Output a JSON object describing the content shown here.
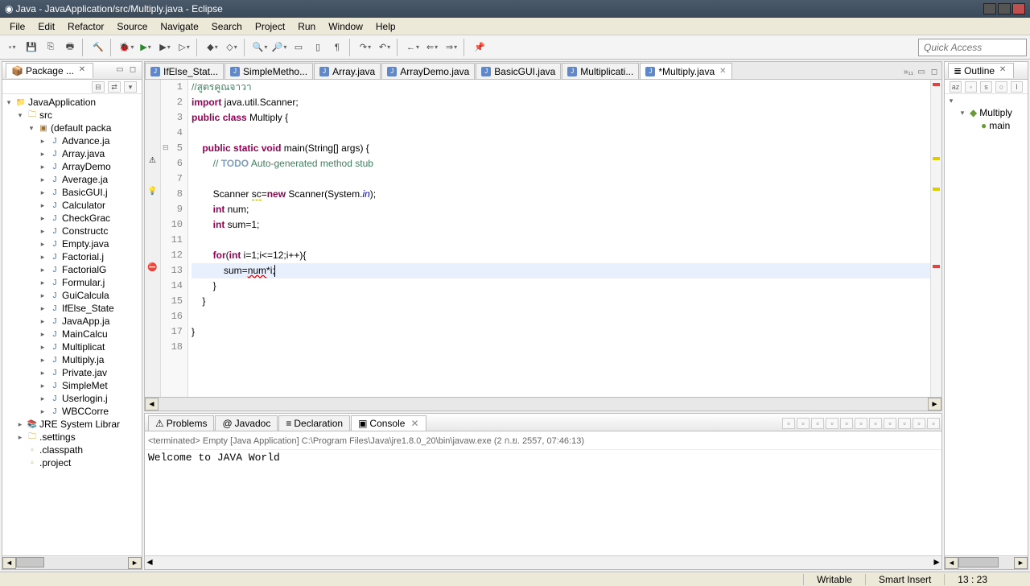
{
  "title": "Java - JavaApplication/src/Multiply.java - Eclipse",
  "menu": [
    "File",
    "Edit",
    "Refactor",
    "Source",
    "Navigate",
    "Search",
    "Project",
    "Run",
    "Window",
    "Help"
  ],
  "quick_access_placeholder": "Quick Access",
  "package_explorer": {
    "title": "Package ...",
    "project": "JavaApplication",
    "src": "src",
    "pkg": "(default packa",
    "files": [
      "Advance.ja",
      "Array.java",
      "ArrayDemo",
      "Average.ja",
      "BasicGUI.j",
      "Calculator",
      "CheckGrac",
      "Constructc",
      "Empty.java",
      "Factorial.j",
      "FactorialG",
      "Formular.j",
      "GuiCalcula",
      "IfElse_State",
      "JavaApp.ja",
      "MainCalcu",
      "Multiplicat",
      "Multiply.ja",
      "Private.jav",
      "SimpleMet",
      "Userlogin.j",
      "WBCCorre"
    ],
    "jre": "JRE System Librar",
    "settings": ".settings",
    "classpath": ".classpath",
    "projfile": ".project"
  },
  "editor_tabs": [
    {
      "label": "IfElse_Stat...",
      "dirty": false
    },
    {
      "label": "SimpleMetho...",
      "dirty": false
    },
    {
      "label": "Array.java",
      "dirty": false
    },
    {
      "label": "ArrayDemo.java",
      "dirty": false
    },
    {
      "label": "BasicGUI.java",
      "dirty": false
    },
    {
      "label": "Multiplicati...",
      "dirty": false
    },
    {
      "label": "*Multiply.java",
      "dirty": true,
      "active": true
    }
  ],
  "overflow_tabs": "»₁₁",
  "code_lines": [
    {
      "n": 1,
      "html": "<span class='cm'>//สูตรคูณจาวา</span>"
    },
    {
      "n": 2,
      "html": "<span class='kw'>import</span> java.util.Scanner;"
    },
    {
      "n": 3,
      "html": "<span class='kw'>public</span> <span class='kw'>class</span> Multiply {"
    },
    {
      "n": 4,
      "html": ""
    },
    {
      "n": 5,
      "html": "    <span class='kw'>public</span> <span class='kw'>static</span> <span class='kw'>void</span> main(String[] args) {",
      "fold": true
    },
    {
      "n": 6,
      "html": "        <span class='cm'>// <span class='kw' style='color:#7f9fbf'>TODO</span> Auto-generated method stub</span>",
      "marker": "⚠"
    },
    {
      "n": 7,
      "html": ""
    },
    {
      "n": 8,
      "html": "        Scanner <span class='squiggle'>sc</span>=<span class='kw'>new</span> Scanner(System.<span class='fld'>in</span>);",
      "marker": "💡"
    },
    {
      "n": 9,
      "html": "        <span class='kw'>int</span> num;"
    },
    {
      "n": 10,
      "html": "        <span class='kw'>int</span> sum=1;"
    },
    {
      "n": 11,
      "html": ""
    },
    {
      "n": 12,
      "html": "        <span class='kw'>for</span>(<span class='kw'>int</span> i=1;i&lt;=12;i++){"
    },
    {
      "n": 13,
      "html": "            sum=<span class='err'>num</span>*i;<span class='cursor'></span>",
      "marker": "⛔",
      "hl": true
    },
    {
      "n": 14,
      "html": "        }"
    },
    {
      "n": 15,
      "html": "    }"
    },
    {
      "n": 16,
      "html": ""
    },
    {
      "n": 17,
      "html": "}"
    },
    {
      "n": 18,
      "html": ""
    }
  ],
  "bottom_tabs": [
    {
      "label": "Problems",
      "icon": "⚠"
    },
    {
      "label": "Javadoc",
      "icon": "@"
    },
    {
      "label": "Declaration",
      "icon": "≡"
    },
    {
      "label": "Console",
      "icon": "▣",
      "active": true,
      "close": true
    }
  ],
  "console_desc": "<terminated> Empty [Java Application] C:\\Program Files\\Java\\jre1.8.0_20\\bin\\javaw.exe (2 ก.ย. 2557, 07:46:13)",
  "console_output": "Welcome to JAVA World",
  "outline": {
    "title": "Outline",
    "items": [
      {
        "label": "Multiply",
        "icon": "◆",
        "color": "#6a9a3a"
      },
      {
        "label": "main",
        "icon": "●",
        "color": "#6a9a3a",
        "indent": true
      }
    ]
  },
  "status": {
    "writable": "Writable",
    "insert": "Smart Insert",
    "pos": "13 : 23"
  }
}
